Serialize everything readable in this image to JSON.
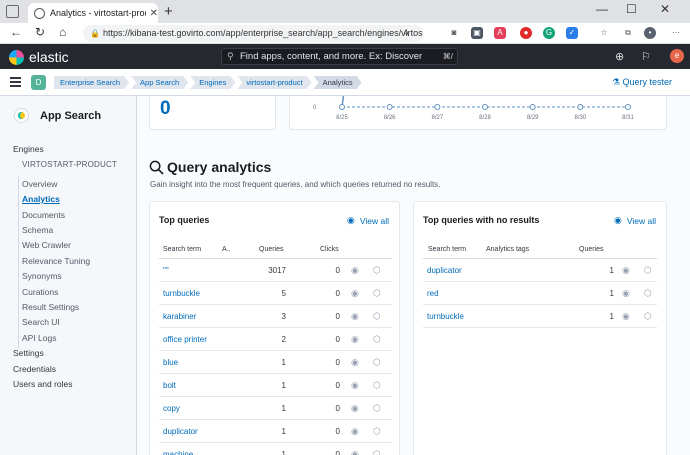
{
  "browser": {
    "tab_title": "Analytics - virtostart-product - E",
    "url": "https://kibana-test.govirto.com/app/enterprise_search/app_search/engines/virtost..."
  },
  "kibana": {
    "logo": "elastic",
    "search_placeholder": "Find apps, content, and more. Ex: Discover",
    "search_shortcut": "⌘/",
    "avatar_initial": "e",
    "space_initial": "D"
  },
  "breadcrumbs": [
    "Enterprise Search",
    "App Search",
    "Engines",
    "virtostart-product",
    "Analytics"
  ],
  "query_tester": "Query tester",
  "sidebar": {
    "app_title": "App Search",
    "engines_label": "Engines",
    "engine_name": "VIRTOSTART-PRODUCT",
    "items": [
      "Overview",
      "Analytics",
      "Documents",
      "Schema",
      "Web Crawler",
      "Relevance Tuning",
      "Synonyms",
      "Curations",
      "Result Settings",
      "Search UI",
      "API Logs"
    ],
    "bottom": [
      "Settings",
      "Credentials",
      "Users and roles"
    ]
  },
  "summary": {
    "value": "0"
  },
  "chart_data": {
    "type": "line",
    "x": [
      "8/25",
      "8/26",
      "8/27",
      "8/28",
      "8/29",
      "8/30",
      "8/31"
    ],
    "y_tick": "0",
    "series": [
      {
        "values": [
          0,
          0,
          0,
          0,
          0,
          0,
          0
        ]
      }
    ]
  },
  "query_analytics": {
    "title": "Query analytics",
    "subtitle": "Gain insight into the most frequent queries, and which queries returned no results."
  },
  "top_queries": {
    "title": "Top queries",
    "view_all": "View all",
    "headers": {
      "term": "Search term",
      "tags": "A..",
      "queries": "Queries",
      "clicks": "Clicks"
    },
    "rows": [
      {
        "term": "\"\"",
        "queries": "3017",
        "clicks": "0"
      },
      {
        "term": "turnbuckle",
        "queries": "5",
        "clicks": "0"
      },
      {
        "term": "karabiner",
        "queries": "3",
        "clicks": "0"
      },
      {
        "term": "office printer",
        "queries": "2",
        "clicks": "0"
      },
      {
        "term": "blue",
        "queries": "1",
        "clicks": "0"
      },
      {
        "term": "bolt",
        "queries": "1",
        "clicks": "0"
      },
      {
        "term": "copy",
        "queries": "1",
        "clicks": "0"
      },
      {
        "term": "duplicator",
        "queries": "1",
        "clicks": "0"
      },
      {
        "term": "machine",
        "queries": "1",
        "clicks": "0"
      }
    ]
  },
  "no_results": {
    "title": "Top queries with no results",
    "view_all": "View all",
    "headers": {
      "term": "Search term",
      "tags": "Analytics tags",
      "queries": "Queries"
    },
    "rows": [
      {
        "term": "duplicator",
        "queries": "1"
      },
      {
        "term": "red",
        "queries": "1"
      },
      {
        "term": "turnbuckle",
        "queries": "1"
      }
    ]
  }
}
